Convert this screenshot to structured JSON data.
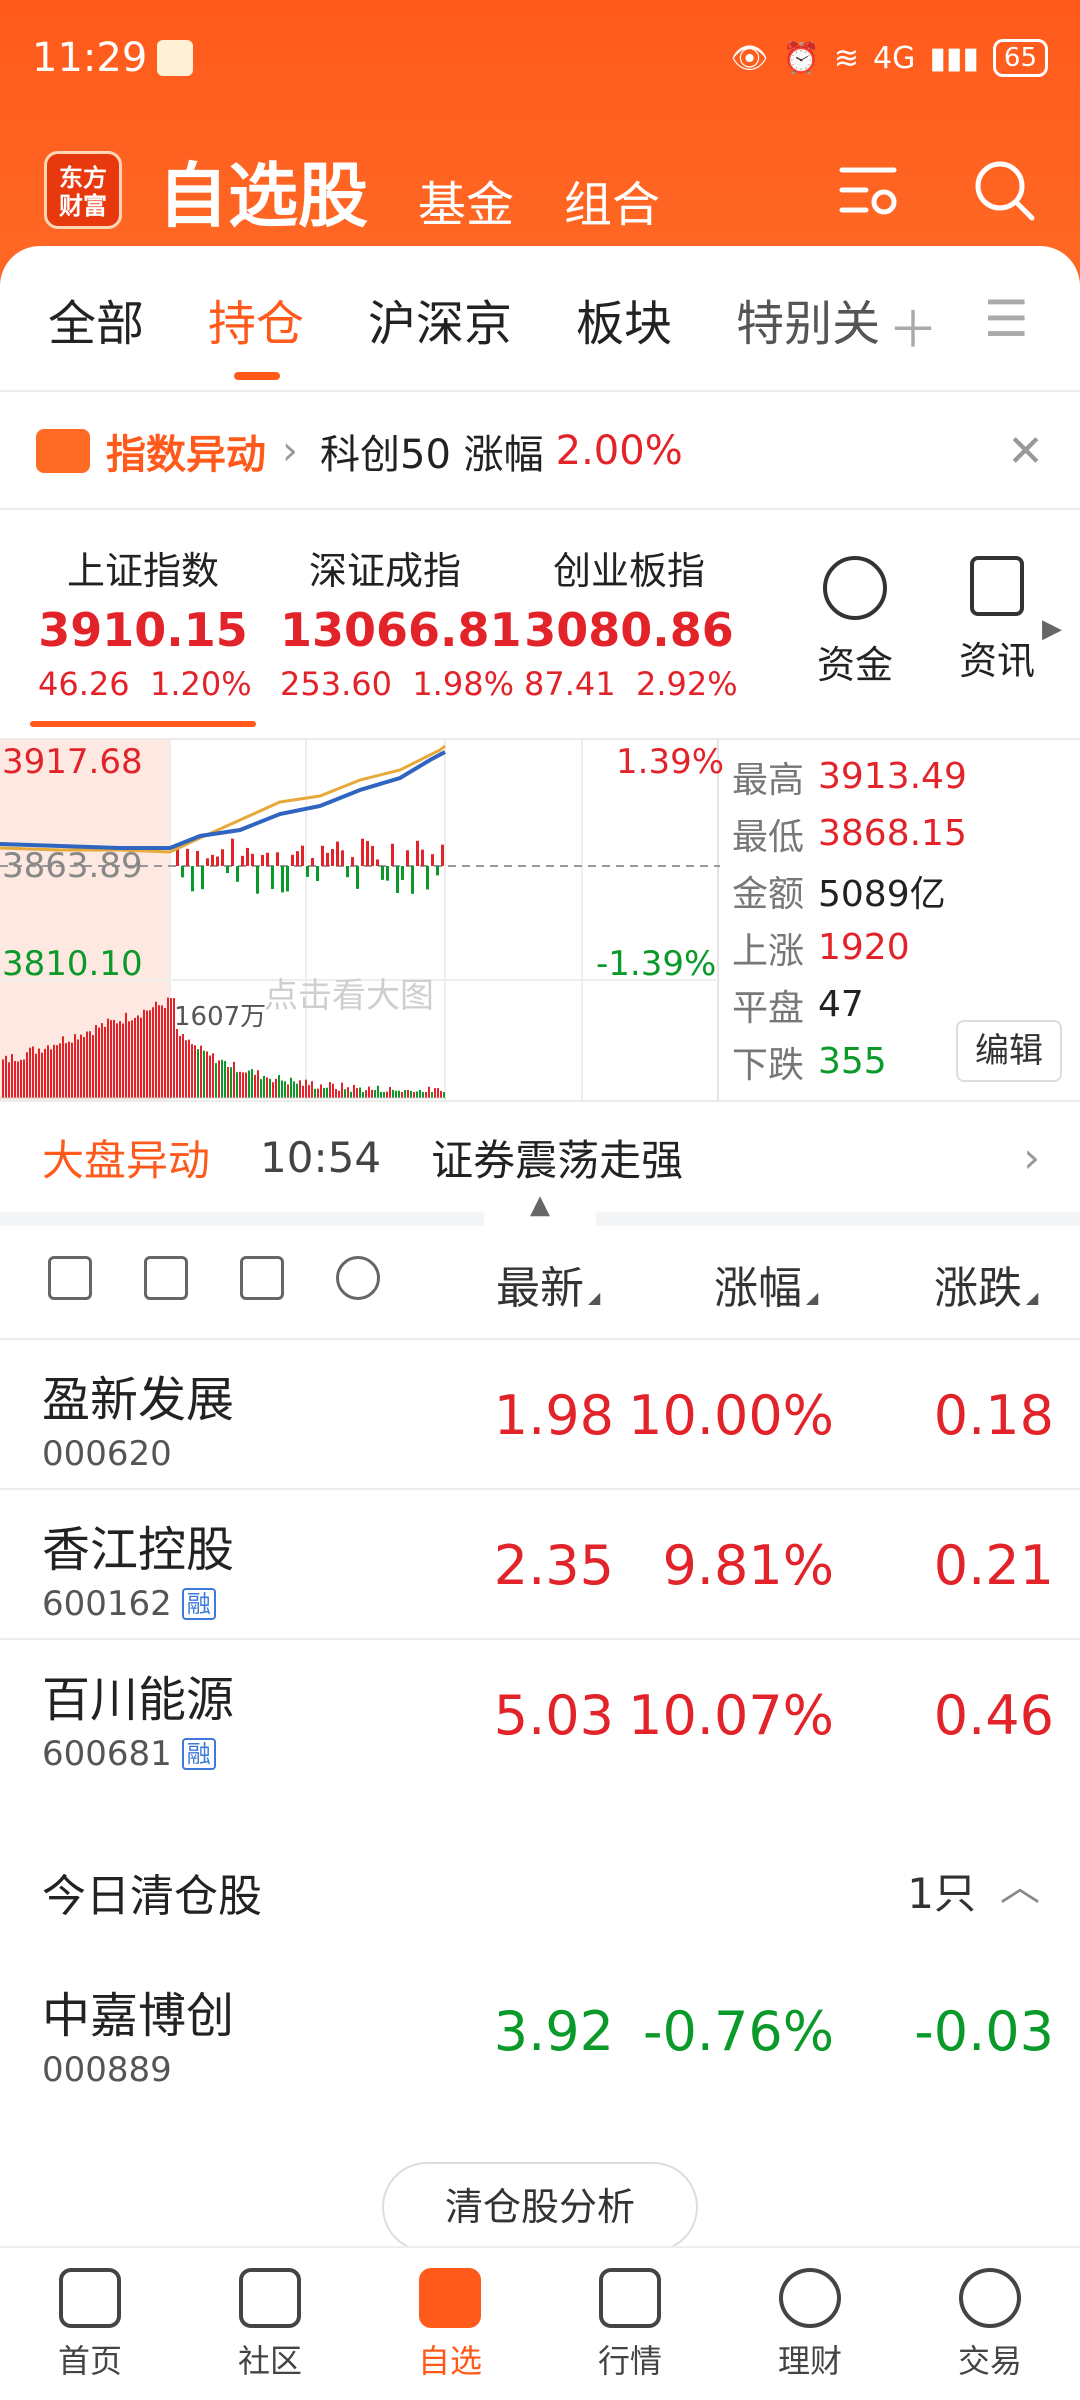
{
  "status_bar": {
    "time": "11:29",
    "battery": "65",
    "network": "4G"
  },
  "header": {
    "logo_text": "东方财富",
    "title": "自选股",
    "links": [
      "基金",
      "组合"
    ],
    "icons": [
      "settings-list-icon",
      "search-icon"
    ]
  },
  "tabs": [
    "全部",
    "持仓",
    "沪深京",
    "板块",
    "特别关"
  ],
  "active_tab": "持仓",
  "alert": {
    "label": "指数异动",
    "text": "科创50 涨幅",
    "pct": "2.00%"
  },
  "indices": [
    {
      "name": "上证指数",
      "value": "3910.15",
      "change": "46.26",
      "pct": "1.20%"
    },
    {
      "name": "深证成指",
      "value": "13066.81",
      "change": "253.60",
      "pct": "1.98%"
    },
    {
      "name": "创业板指",
      "value": "3080.86",
      "change": "87.41",
      "pct": "2.92%"
    }
  ],
  "shortcuts": [
    {
      "label": "资金",
      "icon": "yuan-flow-icon"
    },
    {
      "label": "资讯",
      "icon": "news-icon"
    }
  ],
  "chart": {
    "high_label": "3917.68",
    "mid_label": "3863.89",
    "low_label": "3810.10",
    "high_pct": "1.39%",
    "low_pct": "-1.39%",
    "volume_label": "1607万",
    "watermark": "点击看大图"
  },
  "stats": {
    "high_k": "最高",
    "high_v": "3913.49",
    "low_k": "最低",
    "low_v": "3868.15",
    "amount_k": "金额",
    "amount_v": "5089亿",
    "up_k": "上涨",
    "up_v": "1920",
    "flat_k": "平盘",
    "flat_v": "47",
    "down_k": "下跌",
    "down_v": "355",
    "edit": "编辑"
  },
  "market_move": {
    "label": "大盘异动",
    "time": "10:54",
    "text": "证券震荡走强"
  },
  "list_columns": [
    "最新",
    "涨幅",
    "涨跌"
  ],
  "holdings": [
    {
      "name": "盈新发展",
      "code": "000620",
      "tag": "",
      "price": "1.98",
      "pct": "10.00%",
      "chg": "0.18"
    },
    {
      "name": "香江控股",
      "code": "600162",
      "tag": "融",
      "price": "2.35",
      "pct": "9.81%",
      "chg": "0.21"
    },
    {
      "name": "百川能源",
      "code": "600681",
      "tag": "融",
      "price": "5.03",
      "pct": "10.07%",
      "chg": "0.46"
    }
  ],
  "cleared": {
    "title": "今日清仓股",
    "count": "1只",
    "stock": {
      "name": "中嘉博创",
      "code": "000889",
      "price": "3.92",
      "pct": "-0.76%",
      "chg": "-0.03"
    },
    "button": "清仓股分析"
  },
  "nav": [
    "首页",
    "社区",
    "自选",
    "行情",
    "理财",
    "交易"
  ],
  "colors": {
    "brand": "#ff5a1c",
    "up": "#e2232a",
    "down": "#0a9a2a"
  }
}
